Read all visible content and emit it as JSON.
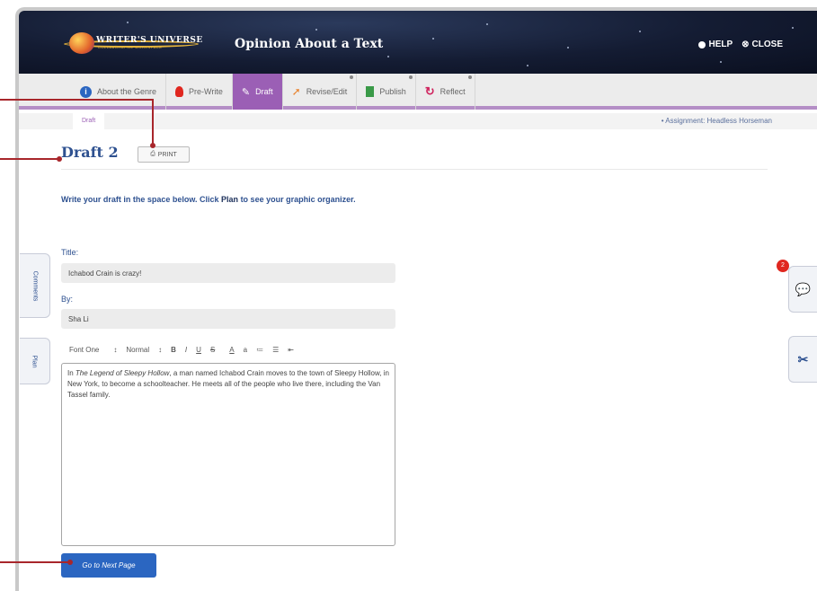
{
  "header": {
    "logo_text": "WRITER'S UNIVERSE",
    "logo_sub": "COLLABORATIVE WORKSPACE",
    "title": "Opinion About a Text",
    "help_label": "HELP",
    "close_label": "CLOSE"
  },
  "tabs": [
    {
      "label": "About the Genre",
      "icon": "info-icon",
      "active": false
    },
    {
      "label": "Pre-Write",
      "icon": "lightbulb-icon",
      "active": false
    },
    {
      "label": "Draft",
      "icon": "pencil-icon",
      "active": true
    },
    {
      "label": "Revise/Edit",
      "icon": "cursor-icon",
      "active": false
    },
    {
      "label": "Publish",
      "icon": "document-icon",
      "active": false
    },
    {
      "label": "Reflect",
      "icon": "refresh-icon",
      "active": false
    }
  ],
  "subbar": {
    "crumb": "Draft",
    "assignment": "• Assignment: Headless Horseman"
  },
  "page": {
    "title": "Draft 2",
    "print_label": "PRINT",
    "instructions_pre": "Write your draft in the space below. Click ",
    "instructions_plan": "Plan",
    "instructions_post": " to see your graphic organizer."
  },
  "form": {
    "title_label": "Title:",
    "title_value": "Ichabod Crain is crazy!",
    "by_label": "By:",
    "by_value": "Sha Li"
  },
  "editor_toolbar": {
    "font": "Font One",
    "size": "Normal",
    "bold": "B",
    "italic": "I",
    "underline": "U",
    "strike": "S",
    "color": "A",
    "highlight": "a"
  },
  "editor": {
    "text_pre": "In ",
    "text_italic": "The Legend of Sleepy Hollow",
    "text_post": ", a man named Ichabod Crain moves to the town of Sleepy Hollow, in New York, to become a schoolteacher. He meets all of the people who live there, including the Van Tassel family."
  },
  "next_button": "Go to Next Page",
  "side_tabs": {
    "comments": "Comments",
    "plan": "Plan"
  },
  "badge_count": "2",
  "colors": {
    "accent": "#9b5fb5",
    "heading": "#2e5190",
    "button": "#2b66c1",
    "callout": "#a8262b"
  }
}
